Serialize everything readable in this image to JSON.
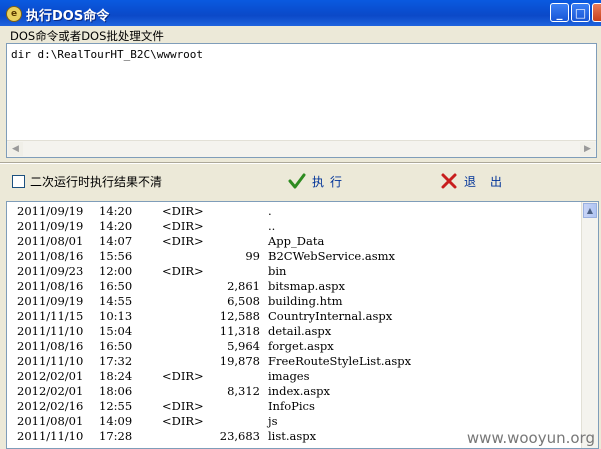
{
  "window": {
    "title": "执行DOS命令",
    "minimize": "_",
    "maximize": "□",
    "close": "✕",
    "icon": "app-icon"
  },
  "command": {
    "label": "DOS命令或者DOS批处理文件",
    "value": "dir d:\\RealTourHT_B2C\\wwwroot"
  },
  "options": {
    "no_clear_label": "二次运行时执行结果不清",
    "no_clear_checked": false
  },
  "buttons": {
    "execute": "执行",
    "exit": "退出",
    "execute_icon": "check-icon",
    "exit_icon": "x-icon",
    "execute_color": "#2e8b20",
    "exit_color": "#c81e1e"
  },
  "results": [
    {
      "date": "2011/09/19",
      "time": "14:20",
      "dir": "<DIR>",
      "size": "",
      "name": "."
    },
    {
      "date": "2011/09/19",
      "time": "14:20",
      "dir": "<DIR>",
      "size": "",
      "name": ".."
    },
    {
      "date": "2011/08/01",
      "time": "14:07",
      "dir": "<DIR>",
      "size": "",
      "name": "App_Data"
    },
    {
      "date": "2011/08/16",
      "time": "15:56",
      "dir": "",
      "size": "99",
      "name": "B2CWebService.asmx"
    },
    {
      "date": "2011/09/23",
      "time": "12:00",
      "dir": "<DIR>",
      "size": "",
      "name": "bin"
    },
    {
      "date": "2011/08/16",
      "time": "16:50",
      "dir": "",
      "size": "2,861",
      "name": "bitsmap.aspx"
    },
    {
      "date": "2011/09/19",
      "time": "14:55",
      "dir": "",
      "size": "6,508",
      "name": "building.htm"
    },
    {
      "date": "2011/11/15",
      "time": "10:13",
      "dir": "",
      "size": "12,588",
      "name": "CountryInternal.aspx"
    },
    {
      "date": "2011/11/10",
      "time": "15:04",
      "dir": "",
      "size": "11,318",
      "name": "detail.aspx"
    },
    {
      "date": "2011/08/16",
      "time": "16:50",
      "dir": "",
      "size": "5,964",
      "name": "forget.aspx"
    },
    {
      "date": "2011/11/10",
      "time": "17:32",
      "dir": "",
      "size": "19,878",
      "name": "FreeRouteStyleList.aspx"
    },
    {
      "date": "2012/02/01",
      "time": "18:24",
      "dir": "<DIR>",
      "size": "",
      "name": "images"
    },
    {
      "date": "2012/02/01",
      "time": "18:06",
      "dir": "",
      "size": "8,312",
      "name": "index.aspx"
    },
    {
      "date": "2012/02/16",
      "time": "12:55",
      "dir": "<DIR>",
      "size": "",
      "name": "InfoPics"
    },
    {
      "date": "2011/08/01",
      "time": "14:09",
      "dir": "<DIR>",
      "size": "",
      "name": "js"
    },
    {
      "date": "2011/11/10",
      "time": "17:28",
      "dir": "",
      "size": "23,683",
      "name": "list.aspx"
    }
  ],
  "watermark": "www.wooyun.org"
}
